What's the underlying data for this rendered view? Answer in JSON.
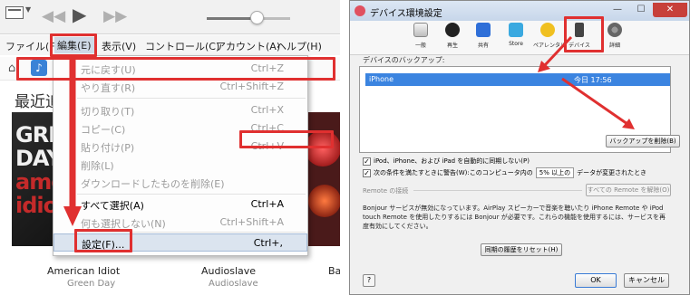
{
  "itunes": {
    "menubar": {
      "file": "ファイル(F)",
      "edit": "編集(E)",
      "view": "表示(V)",
      "controls": "コントロール(C)",
      "account": "アカウント(A)",
      "help": "ヘルプ(H)"
    },
    "section_title": "最近追",
    "edit_menu": [
      {
        "label": "元に戻す(U)",
        "shortcut": "Ctrl+Z",
        "disabled": true
      },
      {
        "label": "やり直す(R)",
        "shortcut": "Ctrl+Shift+Z",
        "disabled": true
      },
      {
        "label": "切り取り(T)",
        "shortcut": "Ctrl+X",
        "disabled": true
      },
      {
        "label": "コピー(C)",
        "shortcut": "Ctrl+C",
        "disabled": true
      },
      {
        "label": "貼り付け(P)",
        "shortcut": "Ctrl+V",
        "disabled": true
      },
      {
        "label": "削除(L)",
        "shortcut": "",
        "disabled": true
      },
      {
        "label": "ダウンロードしたものを削除(E)",
        "shortcut": "",
        "disabled": true
      },
      {
        "label": "すべて選択(A)",
        "shortcut": "Ctrl+A",
        "disabled": false
      },
      {
        "label": "何も選択しない(N)",
        "shortcut": "Ctrl+Shift+A",
        "disabled": true
      },
      {
        "label": "設定(F)...",
        "shortcut": "Ctrl+,",
        "disabled": false
      }
    ],
    "albums": [
      {
        "title": "American Idiot",
        "artist": "Green Day",
        "art_text": "GREEN\nDAY\namer\nidiot"
      },
      {
        "title": "Audioslave",
        "artist": "Audioslave"
      },
      {
        "title": "Bac",
        "artist": ""
      }
    ]
  },
  "dialog": {
    "title": "デバイス環境設定",
    "window_buttons": {
      "min": "—",
      "max": "☐",
      "close": "✕"
    },
    "tabs": [
      {
        "label": "一般",
        "icon": "general-icon"
      },
      {
        "label": "再生",
        "icon": "play-icon"
      },
      {
        "label": "共有",
        "icon": "share-icon"
      },
      {
        "label": "Store",
        "icon": "store-icon"
      },
      {
        "label": "ペアレンタル",
        "icon": "parental-icon"
      },
      {
        "label": "デバイス",
        "icon": "device-icon"
      },
      {
        "label": "詳細",
        "icon": "advanced-icon"
      }
    ],
    "backup_label": "デバイスのバックアップ:",
    "backup_row": {
      "name": "iPhone",
      "date": "今日 17:56"
    },
    "delete_backup": "バックアップを削除(B)",
    "sync_checkbox": "iPod、iPhone、および iPad を自動的に同期しない(P)",
    "warn_checkbox_prefix": "次の条件を満たすときに警告(W):このコンピュータ内の",
    "warn_select": "5% 以上の",
    "warn_checkbox_suffix": "データが変更されたとき",
    "remote_label": "Remote の接続",
    "remote_button": "すべての Remote を解除(O)",
    "bonjour_text": "Bonjour サービスが無効になっています。AirPlay スピーカーで音楽を聴いたり iPhone Remote や iPod touch Remote を使用したりするには Bonjour が必要です。これらの機能を使用するには、サービスを再度有効にしてください。",
    "reset_button": "同期の履歴をリセット(H)",
    "help_button": "?",
    "ok_button": "OK",
    "cancel_button": "キャンセル"
  },
  "colors": {
    "highlight_red": "#e03030",
    "selection_blue": "#3b84e0"
  }
}
